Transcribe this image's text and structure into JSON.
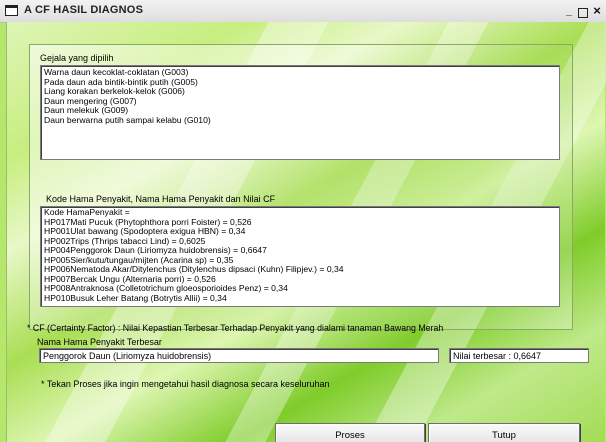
{
  "window": {
    "title": "A CF HASIL DIAGNOS",
    "min_glyph": "_",
    "close_glyph": "×"
  },
  "gejala": {
    "label": "Gejala yang dipilih",
    "items": [
      "Warna daun kecoklat-coklatan (G003)",
      "Pada daun ada bintik-bintik putih (G005)",
      "Liang korakan berkelok-kelok (G006)",
      "Daun mengering (G007)",
      "Daun melekuk (G009)",
      "Daun berwarna putih sampai kelabu (G010)"
    ]
  },
  "hasil": {
    "label": "Kode Hama Penyakit, Nama Hama Penyakit dan Nilai CF",
    "items": [
      "Kode HamaPenyakit =",
      "HP017Mati Pucuk (Phytophthora porri Foister) = 0,526",
      "HP001Ulat bawang (Spodoptera exigua HBN) = 0,34",
      "HP002Trips (Thrips tabacci Lind) = 0,6025",
      "HP004Penggorok Daun (Liriomyza huidobrensis) = 0,6647",
      "HP005Sier/kutu/tungau/mijten (Acarina sp) = 0,35",
      "HP006Nematoda Akar/Ditylenchus (Ditylenchus dipsaci (Kuhn) Filipjev.) = 0,34",
      "HP007Bercak Ungu (Alternaria porri) = 0,526",
      "HP008Antraknosa (Colletotrichum gloeosporioides Penz) = 0,34",
      "HP010Busuk Leher Batang (Botrytis Allii) = 0,34"
    ]
  },
  "cf_note": "* CF (Certainty Factor) : Nilai Kepastian Terbesar Terhadap Penyakit yang dialami tanaman Bawang Merah",
  "terbesar": {
    "label": "Nama Hama Penyakit Terbesar",
    "value": "Penggorok Daun (Liriomyza huidobrensis)",
    "nilai": "Nilai terbesar : 0,6647"
  },
  "proses_note": "* Tekan Proses jika ingin mengetahui hasil diagnosa secara keseluruhan",
  "buttons": {
    "proses": "Proses",
    "tutup": "Tutup"
  }
}
